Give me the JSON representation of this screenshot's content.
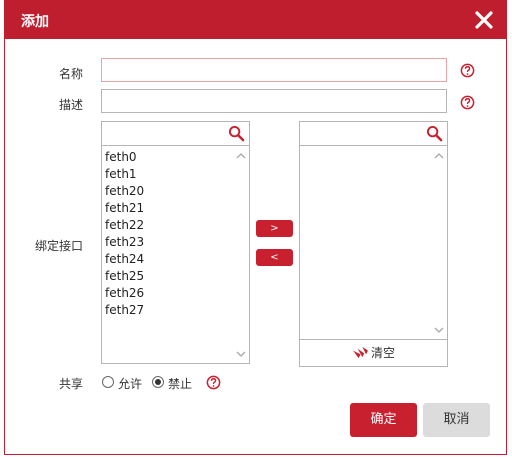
{
  "dialog": {
    "title": "添加",
    "icons": {
      "close": "close-icon",
      "help": "help-icon",
      "search": "search-icon",
      "clear": "clear-icon"
    },
    "colors": {
      "accent": "#bf1e2e",
      "error_border": "#e9a4a4"
    }
  },
  "form": {
    "name_label": "名称",
    "name_value": "",
    "desc_label": "描述",
    "desc_value": "",
    "bind_label": "绑定接口",
    "share_label": "共享"
  },
  "interfaces": {
    "available": [
      "feth0",
      "feth1",
      "feth20",
      "feth21",
      "feth22",
      "feth23",
      "feth24",
      "feth25",
      "feth26",
      "feth27"
    ],
    "selected": [],
    "search_left": "",
    "search_right": "",
    "move_right_label": ">",
    "move_left_label": "<",
    "clear_label": "清空"
  },
  "share": {
    "options": [
      "允许",
      "禁止"
    ],
    "selected": "禁止"
  },
  "buttons": {
    "ok": "确定",
    "cancel": "取消"
  }
}
